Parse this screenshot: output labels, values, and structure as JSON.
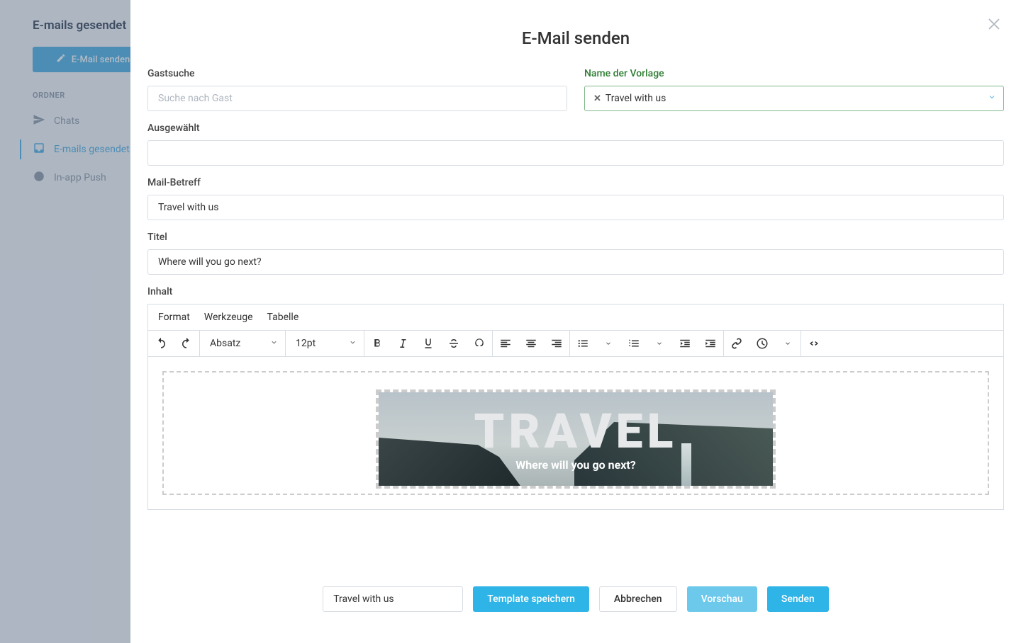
{
  "sidebar": {
    "title": "E-mails gesendet",
    "compose": "E-Mail senden",
    "section": "ORDNER",
    "items": [
      {
        "label": "Chats"
      },
      {
        "label": "E-mails gesendet"
      },
      {
        "label": "In-app Push"
      }
    ]
  },
  "modal": {
    "title": "E-Mail senden",
    "guest_search": {
      "label": "Gastsuche",
      "placeholder": "Suche nach Gast"
    },
    "template_name": {
      "label": "Name der Vorlage",
      "value": "Travel with us"
    },
    "selected": {
      "label": "Ausgewählt",
      "value": ""
    },
    "subject": {
      "label": "Mail-Betreff",
      "value": "Travel with us"
    },
    "title_field": {
      "label": "Titel",
      "value": "Where will you go next?"
    },
    "content_label": "Inhalt",
    "editor": {
      "menus": [
        "Format",
        "Werkzeuge",
        "Tabelle"
      ],
      "block_format": "Absatz",
      "font_size": "12pt",
      "hero_big": "TRAVEL",
      "hero_sub": "Where will you go next?"
    }
  },
  "footer": {
    "template_input": "Travel with us",
    "save_template": "Template speichern",
    "cancel": "Abbrechen",
    "preview": "Vorschau",
    "send": "Senden"
  }
}
